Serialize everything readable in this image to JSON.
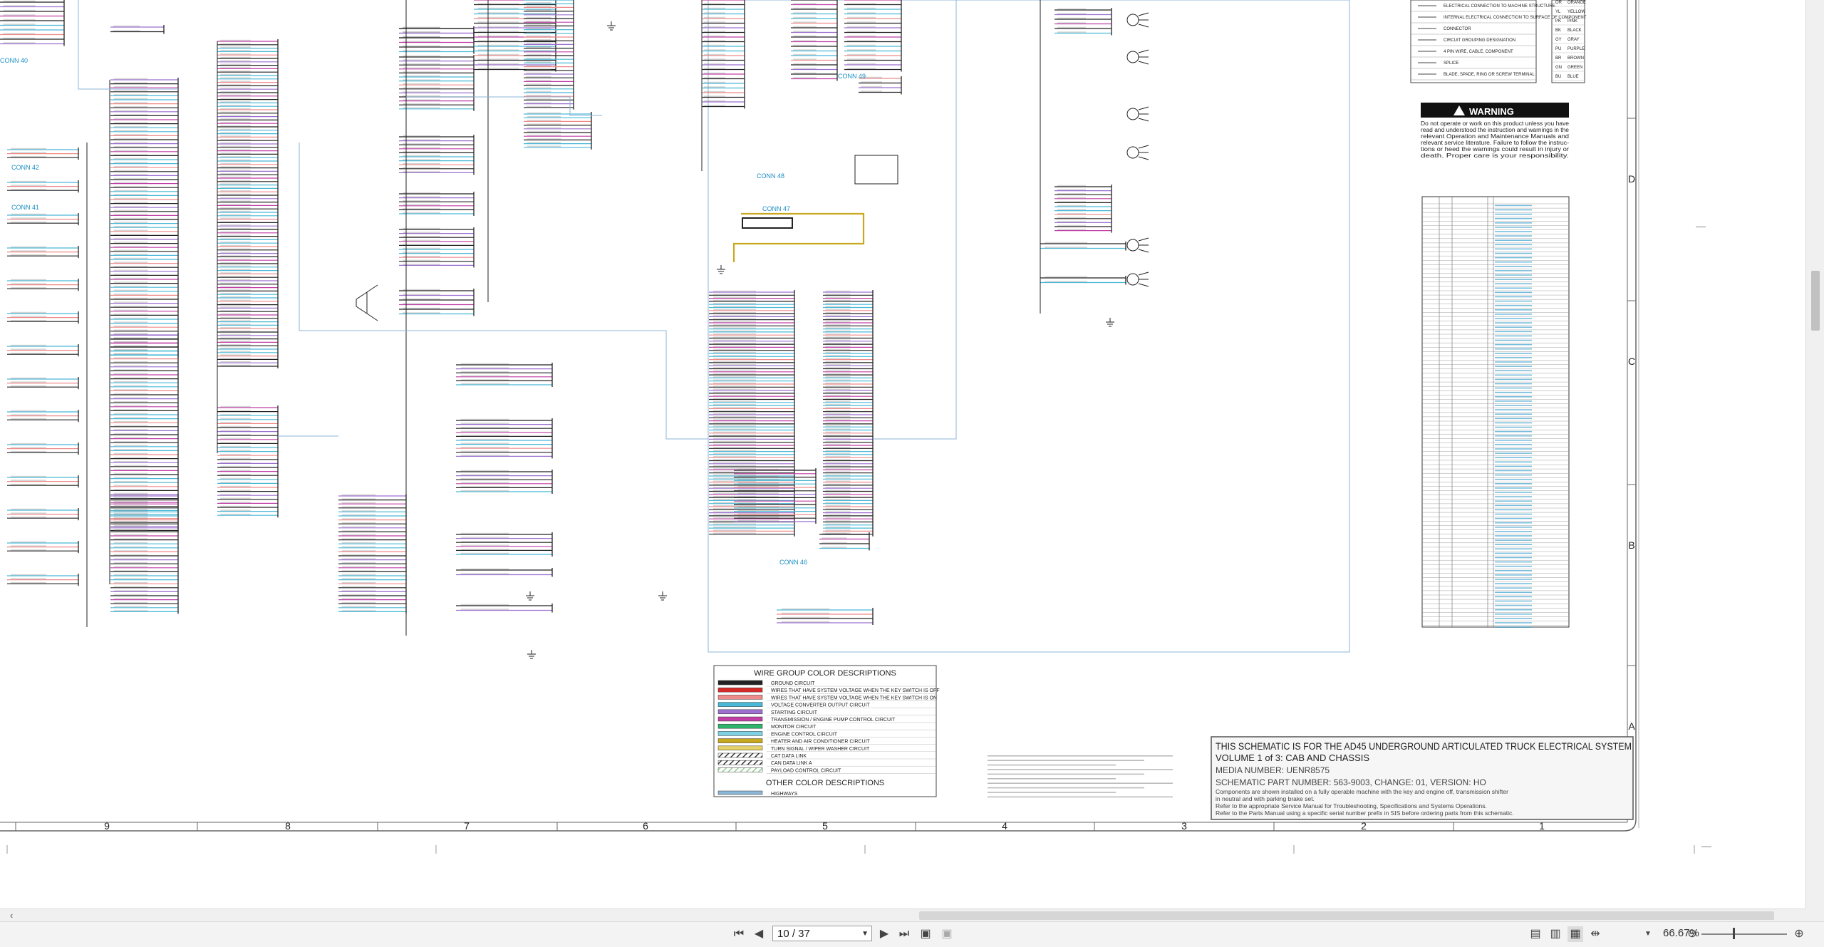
{
  "doc": {
    "columns": [
      "9",
      "8",
      "7",
      "6",
      "5",
      "4",
      "3",
      "2",
      "1"
    ],
    "rows": [
      "D",
      "C",
      "B",
      "A"
    ],
    "connectors": [
      "CONN 42",
      "CONN 41",
      "CONN 47",
      "CONN 48",
      "CONN 49",
      "CONN 46",
      "CONN 40"
    ]
  },
  "legend_codes": {
    "title_rows": [
      "ELECTRICAL CONNECTION TO MACHINE STRUCTURE",
      "INTERNAL ELECTRICAL CONNECTION TO SURFACE OF COMPONENT",
      "CONNECTOR",
      "CIRCUIT GROUPING DESIGNATION",
      "4 PIN WIRE, CABLE, COMPONENT",
      "SPLICE",
      "BLADE, SPADE, RING OR SCREW TERMINAL"
    ],
    "colors": [
      {
        "code": "OR",
        "name": "ORANGE"
      },
      {
        "code": "YL",
        "name": "YELLOW"
      },
      {
        "code": "PK",
        "name": "PINK"
      },
      {
        "code": "BK",
        "name": "BLACK"
      },
      {
        "code": "GY",
        "name": "GRAY"
      },
      {
        "code": "PU",
        "name": "PURPLE"
      },
      {
        "code": "BR",
        "name": "BROWN"
      },
      {
        "code": "GN",
        "name": "GREEN"
      },
      {
        "code": "BU",
        "name": "BLUE"
      }
    ]
  },
  "warning": {
    "title": "WARNING",
    "lines": [
      "Do not operate or work on this product unless you have",
      "read and understood the instruction and warnings in the",
      "relevant Operation and Maintenance Manuals and",
      "relevant service literature. Failure to follow the instruc-",
      "tions or heed the warnings could result in injury or",
      "death. Proper care is your responsibility."
    ]
  },
  "wire_groups": {
    "title": "WIRE GROUP COLOR DESCRIPTIONS",
    "items": [
      {
        "label": "GROUND CIRCUIT",
        "color": "#222222",
        "pattern": "solid"
      },
      {
        "label": "WIRES THAT HAVE SYSTEM VOLTAGE WHEN THE KEY SWITCH IS OFF",
        "color": "#d42a2a",
        "pattern": "solid"
      },
      {
        "label": "WIRES THAT HAVE SYSTEM VOLTAGE WHEN THE KEY SWITCH IS ON",
        "color": "#ef8a8a",
        "pattern": "solid"
      },
      {
        "label": "VOLTAGE CONVERTER OUTPUT CIRCUIT",
        "color": "#49b8d6",
        "pattern": "solid"
      },
      {
        "label": "STARTING CIRCUIT",
        "color": "#9c6fd0",
        "pattern": "solid"
      },
      {
        "label": "TRANSMISSION / ENGINE PUMP CONTROL CIRCUIT",
        "color": "#c03fa6",
        "pattern": "solid"
      },
      {
        "label": "MONITOR CIRCUIT",
        "color": "#2db36a",
        "pattern": "solid"
      },
      {
        "label": "ENGINE CONTROL CIRCUIT",
        "color": "#7fd1e6",
        "pattern": "solid"
      },
      {
        "label": "HEATER AND AIR CONDITIONER CIRCUIT",
        "color": "#c8a81e",
        "pattern": "solid"
      },
      {
        "label": "TURN SIGNAL / WIPER WASHER CIRCUIT",
        "color": "#e6d26b",
        "pattern": "solid"
      },
      {
        "label": "CAT DATA LINK",
        "color": "#333333",
        "pattern": "hatch"
      },
      {
        "label": "CAN DATA LINK A",
        "color": "#555555",
        "pattern": "hatch"
      },
      {
        "label": "PAYLOAD CONTROL CIRCUIT",
        "color": "#8fcf8f",
        "pattern": "hatch"
      }
    ],
    "other_title": "OTHER COLOR DESCRIPTIONS",
    "other_items": [
      {
        "label": "HIGHWAYS",
        "color": "#8bb6d8",
        "pattern": "solid"
      }
    ]
  },
  "title_block": {
    "line1": "THIS SCHEMATIC IS FOR THE AD45 UNDERGROUND ARTICULATED TRUCK ELECTRICAL SYSTEM",
    "line2": "VOLUME 1 of 3: CAB AND CHASSIS",
    "line3": "MEDIA NUMBER: UENR8575",
    "line4": "SCHEMATIC PART NUMBER: 563-9003, CHANGE: 01, VERSION: HO",
    "line5": "Components are shown installed on a fully operable machine with the key and engine off, transmission shifter",
    "line6": "in neutral and with parking brake set.",
    "line7": "Refer to the appropriate Service Manual for Troubleshooting, Specifications and Systems Operations.",
    "line8": "Refer to the Parts Manual using a specific serial number prefix in SIS before ordering parts from this schematic."
  },
  "viewer": {
    "page_label": "10 / 37",
    "zoom": "66.67%"
  },
  "colors": {
    "frame": "#666666",
    "highway": "#8bb6d8",
    "link": "#1a8fc4",
    "warning_bg": "#111111"
  }
}
